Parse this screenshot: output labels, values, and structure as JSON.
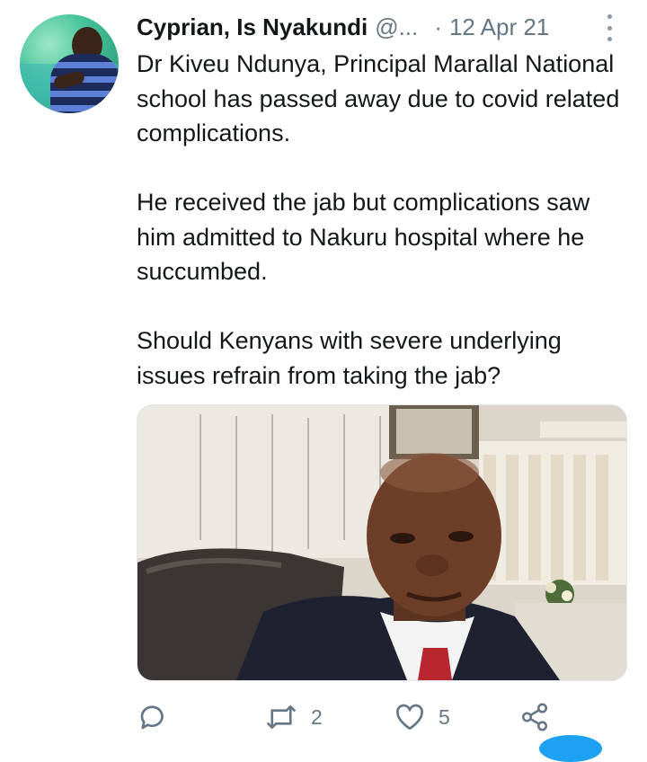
{
  "tweet": {
    "author_name": "Cyprian, Is Nyakundi",
    "author_handle": "@...",
    "separator": "·",
    "date": "12 Apr 21",
    "paragraphs": [
      "Dr Kiveu Ndunya, Principal Marallal National school has passed away due to covid related complications.",
      "He received the jab but complications saw him admitted to Nakuru hospital where he succumbed.",
      "Should Kenyans with severe underlying issues refrain from taking the jab?"
    ]
  },
  "actions": {
    "reply_icon": "reply-icon",
    "retweet_icon": "retweet-icon",
    "retweet_count": "2",
    "like_icon": "heart-icon",
    "like_count": "5",
    "share_icon": "share-icon"
  },
  "colors": {
    "text": "#14171a",
    "secondary": "#657786",
    "accent": "#1da1f2"
  }
}
